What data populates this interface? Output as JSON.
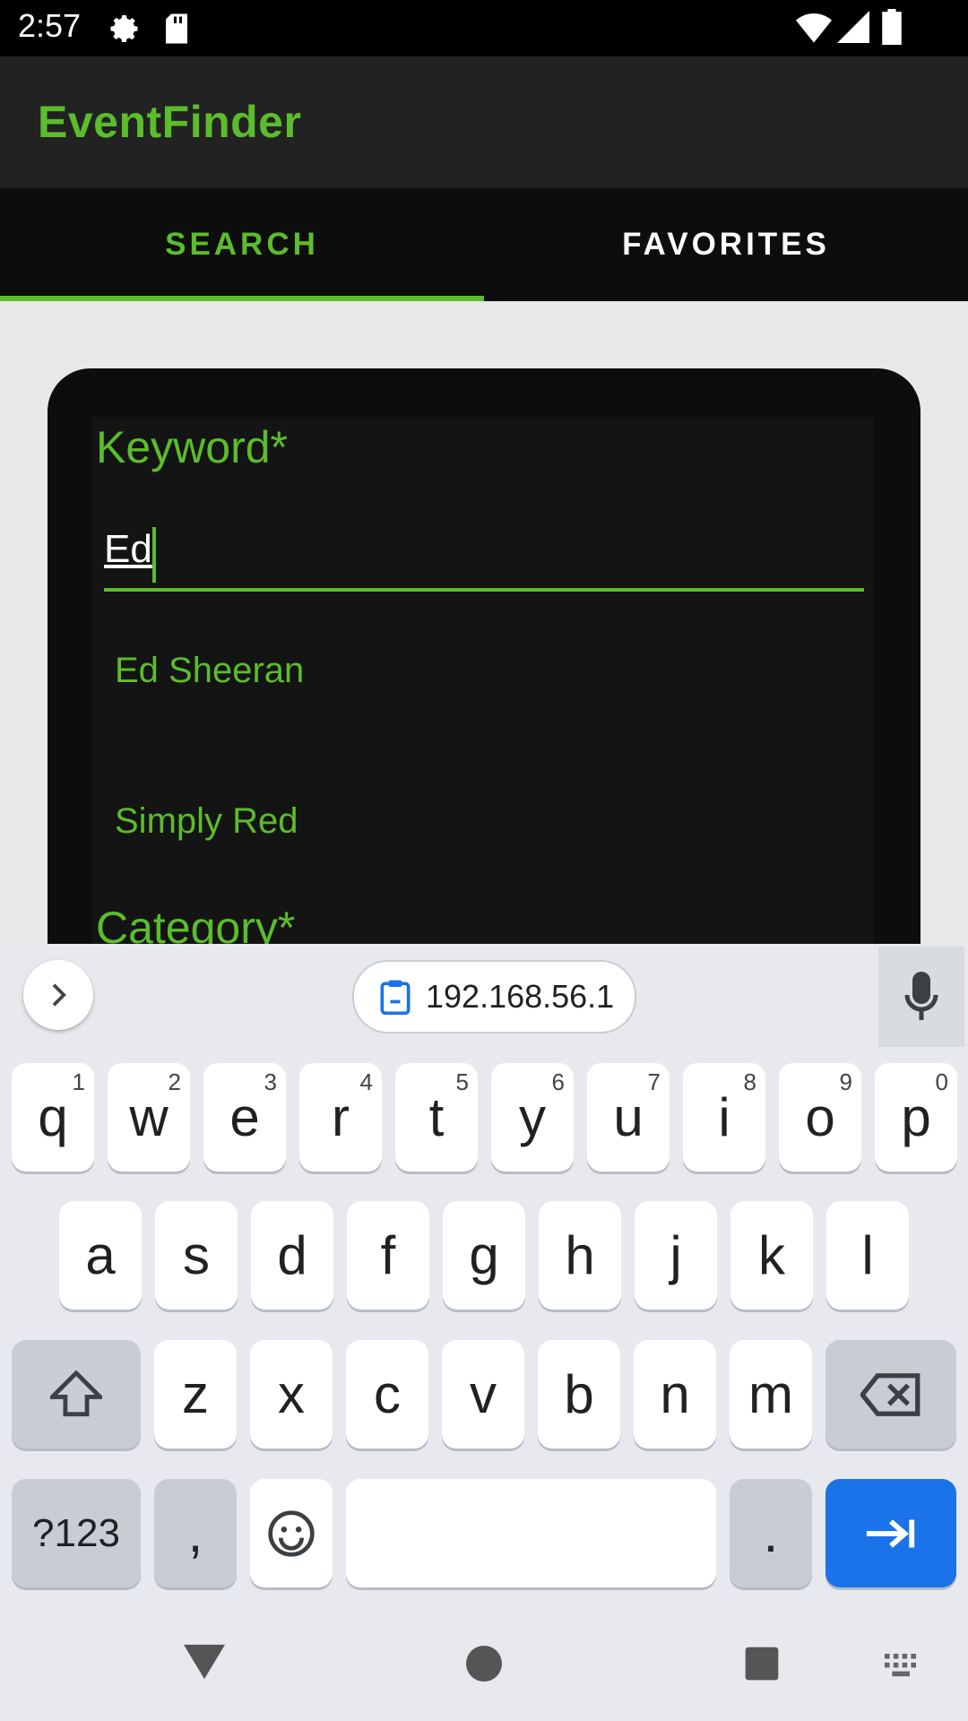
{
  "status_bar": {
    "time": "2:57",
    "icons": [
      "settings-icon",
      "sd-card-icon",
      "wifi-icon",
      "signal-icon",
      "battery-icon"
    ]
  },
  "app": {
    "title": "EventFinder"
  },
  "tabs": [
    {
      "label": "SEARCH",
      "active": true
    },
    {
      "label": "FAVORITES",
      "active": false
    }
  ],
  "form": {
    "keyword_label": "Keyword*",
    "keyword_value": "Ed",
    "suggestions": [
      "Ed Sheeran",
      "Simply Red"
    ],
    "category_label": "Category*"
  },
  "keyboard": {
    "clipboard_chip": "192.168.56.1",
    "row1": [
      {
        "k": "q",
        "h": "1"
      },
      {
        "k": "w",
        "h": "2"
      },
      {
        "k": "e",
        "h": "3"
      },
      {
        "k": "r",
        "h": "4"
      },
      {
        "k": "t",
        "h": "5"
      },
      {
        "k": "y",
        "h": "6"
      },
      {
        "k": "u",
        "h": "7"
      },
      {
        "k": "i",
        "h": "8"
      },
      {
        "k": "o",
        "h": "9"
      },
      {
        "k": "p",
        "h": "0"
      }
    ],
    "row2": [
      "a",
      "s",
      "d",
      "f",
      "g",
      "h",
      "j",
      "k",
      "l"
    ],
    "row3": [
      "z",
      "x",
      "c",
      "v",
      "b",
      "n",
      "m"
    ],
    "symbols_key": "?123",
    "comma_key": ",",
    "period_key": "."
  },
  "colors": {
    "accent": "#5bbd2b",
    "keyboard_blue": "#1a73e8"
  }
}
